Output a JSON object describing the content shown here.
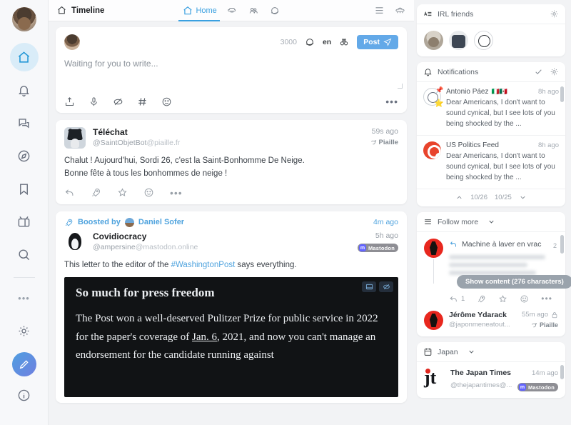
{
  "rail": {
    "avatar_name": "user-avatar",
    "items": [
      {
        "name": "home",
        "icon": "home-icon",
        "active": true
      },
      {
        "name": "notifications",
        "icon": "bell-icon",
        "active": false
      },
      {
        "name": "conversations",
        "icon": "chat-bubbles-icon",
        "active": false
      },
      {
        "name": "explore",
        "icon": "compass-icon",
        "active": false
      },
      {
        "name": "bookmarks",
        "icon": "bookmark-icon",
        "active": false
      },
      {
        "name": "lists",
        "icon": "tv-icon",
        "active": false
      },
      {
        "name": "search",
        "icon": "magnifier-icon",
        "active": false
      }
    ],
    "more_label": "•••",
    "settings_icon": "gear-icon",
    "compose_icon": "pencil-icon",
    "info_icon": "info-circle-icon"
  },
  "topbar": {
    "title": "Timeline",
    "title_icon": "home-icon",
    "tabs": [
      {
        "label": "Home",
        "icon": "home-icon",
        "active": true
      },
      {
        "label": "",
        "icon": "brain-icon",
        "active": false
      },
      {
        "label": "",
        "icon": "people-icon",
        "active": false
      },
      {
        "label": "",
        "icon": "planet-icon",
        "active": false
      }
    ],
    "right_icons": [
      {
        "name": "list-view-icon"
      },
      {
        "name": "ufo-icon"
      }
    ]
  },
  "compose": {
    "char_count": "3000",
    "visibility_icon": "planet-icon",
    "language": "en",
    "preview_icon": "binoculars-icon",
    "post_label": "Post",
    "post_icon": "send-icon",
    "placeholder": "Waiting for you to write...",
    "tools": [
      {
        "name": "upload-icon"
      },
      {
        "name": "microphone-icon"
      },
      {
        "name": "content-warning-icon"
      },
      {
        "name": "hashtag-icon"
      },
      {
        "name": "emoji-icon"
      }
    ],
    "more_label": "•••"
  },
  "posts": [
    {
      "display_name": "Téléchat",
      "handle_user": "@SaintObjetBot",
      "handle_domain": "@piaille.fr",
      "time": "59s ago",
      "source": "Piaille",
      "text_lines": [
        "Chalut ! Aujourd'hui, Sordi 26, c'est la Saint-Bonhomme De Neige.",
        "Bonne fête à tous les bonhommes de neige !"
      ],
      "actions": [
        "reply-icon",
        "boost-icon",
        "favorite-icon",
        "emoji-icon"
      ],
      "more_label": "•••"
    },
    {
      "boosted_by_label": "Boosted by",
      "boosted_by_name": "Daniel Sofer",
      "boost_time": "4m ago",
      "display_name": "Covidiocracy",
      "handle_user": "@ampersine",
      "handle_domain": "@mastodon.online",
      "time": "5h ago",
      "source_badge": "Mastodon",
      "text_pre": "This letter to the editor of the ",
      "text_tag": "#WashingtonPost",
      "text_post": " says everything.",
      "media": {
        "heading": "So much for press freedom",
        "body": "The Post won a well-deserved Pulitzer Prize for public service in 2022 for the paper's coverage of ",
        "body_underline": "Jan. 6",
        "body_rest": ", 2021, and now you can't manage an endorsement for the candidate running against",
        "buttons": [
          {
            "name": "alt-text-icon"
          },
          {
            "name": "hide-media-icon"
          }
        ]
      }
    }
  ],
  "right": {
    "friends_panel": {
      "title": "IRL friends",
      "lead_icon": "list-letters-icon",
      "settings_icon": "gear-icon",
      "avatars": [
        "friend-avatar-1",
        "friend-avatar-2",
        "friend-avatar-3"
      ]
    },
    "notifications_panel": {
      "title": "Notifications",
      "lead_icon": "bell-icon",
      "check_icon": "check-icon",
      "settings_icon": "gear-icon",
      "items": [
        {
          "name": "Antonio Páez",
          "flags": "🇮🇹🇲🇽",
          "time": "8h ago",
          "text": "Dear Americans,  I don't want to sound cynical, but I see lots of you being shocked by the ..."
        },
        {
          "name": "US Politics Feed",
          "flags": "",
          "time": "8h ago",
          "text": "Dear Americans,  I don't want to sound cynical, but I see lots of you being shocked by the ..."
        }
      ],
      "pager": {
        "up_icon": "chevron-up-icon",
        "date_current": "10/26",
        "date_previous": "10/25",
        "down_icon": "chevron-down-icon"
      }
    },
    "follow_panel": {
      "title": "Follow more",
      "lead_icon": "list-icon",
      "chevron_icon": "chevron-down-icon",
      "thread": {
        "corner_count": "2",
        "reply_icon": "reply-arrow-icon",
        "title": "Machine à laver en vrac",
        "show_content_label": "Show content (276 characters)",
        "reply_count": "1",
        "actions": [
          "reply-icon",
          "boost-icon",
          "favorite-icon",
          "emoji-icon"
        ],
        "more_label": "•••"
      },
      "author": {
        "name": "Jérôme Ydarack",
        "handle": "@japonmeneatout...",
        "time": "55m ago",
        "lock_icon": "lock-icon",
        "source": "Piaille"
      }
    },
    "japan_panel": {
      "title": "Japan",
      "lead_icon": "calendar-icon",
      "chevron_icon": "chevron-down-icon",
      "item": {
        "logo_text": "jt",
        "name": "The Japan Times",
        "handle": "@thejapantimes@...",
        "time": "14m ago",
        "badge": "Mastodon"
      }
    }
  },
  "colors": {
    "accent": "#3aa0e0",
    "post_button": "#63a9e8",
    "active_rail_bg": "#d9ecf8",
    "mastodon_purple": "#6364ff",
    "page_bg": "#f2f3f5"
  }
}
